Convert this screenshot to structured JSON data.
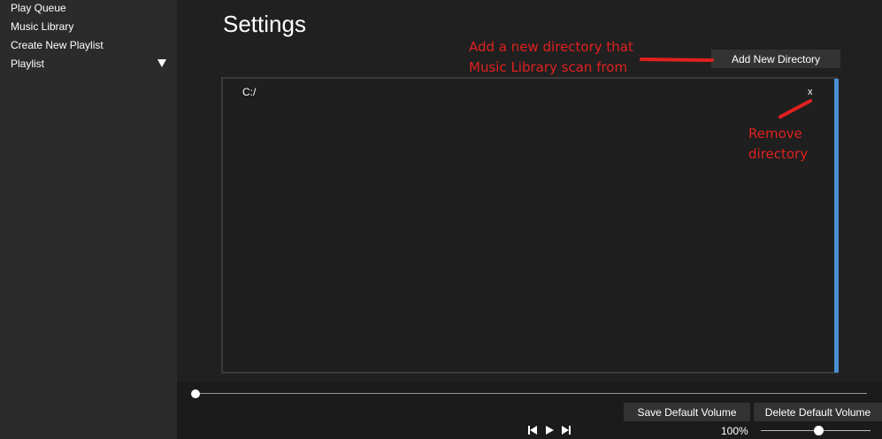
{
  "sidebar": {
    "items": [
      {
        "label": "Play Queue"
      },
      {
        "label": "Music Library"
      },
      {
        "label": "Create New Playlist"
      },
      {
        "label": "Playlist"
      }
    ]
  },
  "settings": {
    "title": "Settings",
    "add_directory_label": "Add New Directory",
    "directories": [
      {
        "path": "C:/",
        "remove_label": "x"
      }
    ]
  },
  "annotations": {
    "add_note": "Add a new directory that\nMusic Library scan from",
    "remove_note": "Remove\ndirectory"
  },
  "player": {
    "save_default_volume": "Save Default Volume",
    "delete_default_volume": "Delete Default Volume",
    "volume_text": "100%",
    "seek_position": 0,
    "volume_level": 0.5
  },
  "colors": {
    "accent": "#4a8fd1",
    "annotation": "#e02020",
    "sidebar_bg": "#2b2b2b",
    "main_bg": "#202020"
  }
}
